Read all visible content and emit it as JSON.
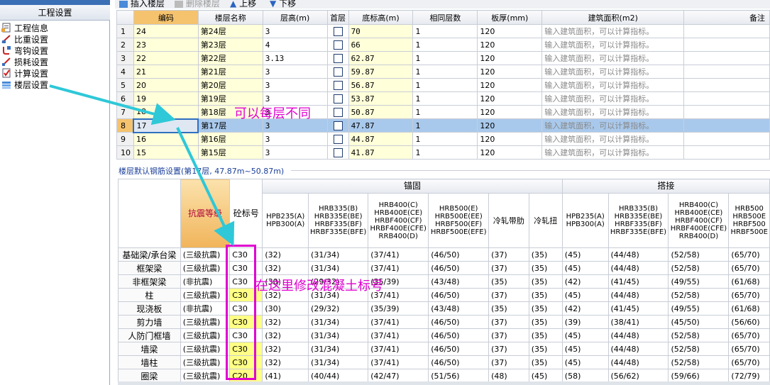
{
  "left": {
    "title": "工程设置",
    "items": [
      "工程信息",
      "比重设置",
      "弯钩设置",
      "损耗设置",
      "计算设置",
      "楼层设置"
    ]
  },
  "toolbar": {
    "insert": "插入楼层",
    "delete": "删除楼层",
    "up": "上移",
    "down": "下移"
  },
  "floor_table": {
    "headers": [
      "编码",
      "楼层名称",
      "层高(m)",
      "首层",
      "底标高(m)",
      "相同层数",
      "板厚(mm)",
      "建筑面积(m2)",
      "备注"
    ],
    "rows": [
      {
        "n": "1",
        "code": "24",
        "name": "第24层",
        "h": "3",
        "base": "70",
        "same": "1",
        "thick": "120",
        "area": "输入建筑面积，可以计算指标。"
      },
      {
        "n": "2",
        "code": "23",
        "name": "第23层",
        "h": "4",
        "base": "66",
        "same": "1",
        "thick": "120",
        "area": "输入建筑面积，可以计算指标。"
      },
      {
        "n": "3",
        "code": "22",
        "name": "第22层",
        "h": "3.13",
        "base": "62.87",
        "same": "1",
        "thick": "120",
        "area": "输入建筑面积，可以计算指标。"
      },
      {
        "n": "4",
        "code": "21",
        "name": "第21层",
        "h": "3",
        "base": "59.87",
        "same": "1",
        "thick": "120",
        "area": "输入建筑面积，可以计算指标。"
      },
      {
        "n": "5",
        "code": "20",
        "name": "第20层",
        "h": "3",
        "base": "56.87",
        "same": "1",
        "thick": "120",
        "area": "输入建筑面积，可以计算指标。"
      },
      {
        "n": "6",
        "code": "19",
        "name": "第19层",
        "h": "3",
        "base": "53.87",
        "same": "1",
        "thick": "120",
        "area": "输入建筑面积，可以计算指标。"
      },
      {
        "n": "7",
        "code": "18",
        "name": "第18层",
        "h": "3",
        "base": "50.87",
        "same": "1",
        "thick": "120",
        "area": "输入建筑面积，可以计算指标。"
      },
      {
        "n": "8",
        "code": "17",
        "name": "第17层",
        "h": "3",
        "base": "47.87",
        "same": "1",
        "thick": "120",
        "area": "输入建筑面积，可以计算指标。"
      },
      {
        "n": "9",
        "code": "16",
        "name": "第16层",
        "h": "3",
        "base": "44.87",
        "same": "1",
        "thick": "120",
        "area": "输入建筑面积，可以计算指标。"
      },
      {
        "n": "10",
        "code": "15",
        "name": "第15层",
        "h": "3",
        "base": "41.87",
        "same": "1",
        "thick": "120",
        "area": "输入建筑面积，可以计算指标。"
      }
    ]
  },
  "section_label": "楼层默认钢筋设置(第17层, 47.87m~50.87m)",
  "rebar": {
    "kz_header": "抗震等级",
    "concrete_header": "砼标号",
    "anchor_group": "锚固",
    "lap_group": "搭接",
    "col_headers": [
      "HPB235(A)\nHPB300(A)",
      "HRB335(B)\nHRB335E(BE)\nHRBF335(BF)\nHRBF335E(BFE)",
      "HRB400(C)\nHRB400E(CE)\nHRBF400(CF)\nHRBF400E(CFE)\nRRB400(D)",
      "HRB500(E)\nHRB500E(EE)\nHRBF500(EF)\nHRBF500E(EFE)",
      "冷轧带肋",
      "冷轧扭",
      "HPB235(A)\nHPB300(A)",
      "HRB335(B)\nHRB335E(BE)\nHRBF335(BF)\nHRBF335E(BFE)",
      "HRB400(C)\nHRB400E(CE)\nHRBF400(CF)\nHRBF400E(CFE)\nRRB400(D)",
      "HRB500\nHRB500E\nHRBF500\nHRBF500E"
    ],
    "rows": [
      {
        "name": "基础梁/承台梁",
        "kz": "(三级抗震)",
        "c": "C30",
        "y": false,
        "v": [
          "(32)",
          "(31/34)",
          "(37/41)",
          "(46/50)",
          "(37)",
          "(35)",
          "(45)",
          "(44/48)",
          "(52/58)",
          "(65/70)"
        ]
      },
      {
        "name": "框架梁",
        "kz": "(三级抗震)",
        "c": "C30",
        "y": false,
        "v": [
          "(32)",
          "(31/34)",
          "(37/41)",
          "(46/50)",
          "(37)",
          "(35)",
          "(45)",
          "(44/48)",
          "(52/58)",
          "(65/70)"
        ]
      },
      {
        "name": "非框架梁",
        "kz": "(非抗震)",
        "c": "C30",
        "y": false,
        "v": [
          "(30)",
          "(29/32)",
          "(35/39)",
          "(43/48)",
          "(35)",
          "(35)",
          "(42)",
          "(41/45)",
          "(49/55)",
          "(61/68)"
        ]
      },
      {
        "name": "柱",
        "kz": "(三级抗震)",
        "c": "C30",
        "y": true,
        "v": [
          "(32)",
          "(31/34)",
          "(37/41)",
          "(46/50)",
          "(37)",
          "(35)",
          "(45)",
          "(44/48)",
          "(52/58)",
          "(65/70)"
        ]
      },
      {
        "name": "现浇板",
        "kz": "(非抗震)",
        "c": "C30",
        "y": false,
        "v": [
          "(30)",
          "(29/32)",
          "(35/39)",
          "(43/48)",
          "(35)",
          "(35)",
          "(42)",
          "(41/45)",
          "(49/55)",
          "(61/68)"
        ]
      },
      {
        "name": "剪力墙",
        "kz": "(三级抗震)",
        "c": "C30",
        "y": true,
        "v": [
          "(32)",
          "(31/34)",
          "(37/41)",
          "(46/50)",
          "(37)",
          "(35)",
          "(39)",
          "(38/41)",
          "(45/50)",
          "(56/60)"
        ]
      },
      {
        "name": "人防门框墙",
        "kz": "(三级抗震)",
        "c": "C30",
        "y": false,
        "v": [
          "(32)",
          "(31/34)",
          "(37/41)",
          "(46/50)",
          "(37)",
          "(35)",
          "(45)",
          "(44/48)",
          "(52/58)",
          "(65/70)"
        ]
      },
      {
        "name": "墙梁",
        "kz": "(三级抗震)",
        "c": "C30",
        "y": true,
        "v": [
          "(32)",
          "(31/34)",
          "(37/41)",
          "(46/50)",
          "(37)",
          "(35)",
          "(45)",
          "(44/48)",
          "(52/58)",
          "(65/70)"
        ]
      },
      {
        "name": "墙柱",
        "kz": "(三级抗震)",
        "c": "C30",
        "y": true,
        "v": [
          "(32)",
          "(31/34)",
          "(37/41)",
          "(46/50)",
          "(37)",
          "(35)",
          "(45)",
          "(44/48)",
          "(52/58)",
          "(65/70)"
        ]
      },
      {
        "name": "圈梁",
        "kz": "(三级抗震)",
        "c": "C20",
        "y": true,
        "v": [
          "(41)",
          "(40/44)",
          "(42/47)",
          "(51/56)",
          "(48)",
          "(45)",
          "(58)",
          "(56/62)",
          "(59/66)",
          "(72/79)"
        ]
      }
    ]
  },
  "annotations": {
    "per_floor": "可以每层不同",
    "modify_here": "在这里修改混凝土标号"
  },
  "colors": {
    "annotation": "#e000d0",
    "arrow": "#2ec8d8",
    "selected_row": "#a9c9ec",
    "header_highlight": "#f5c36e"
  }
}
